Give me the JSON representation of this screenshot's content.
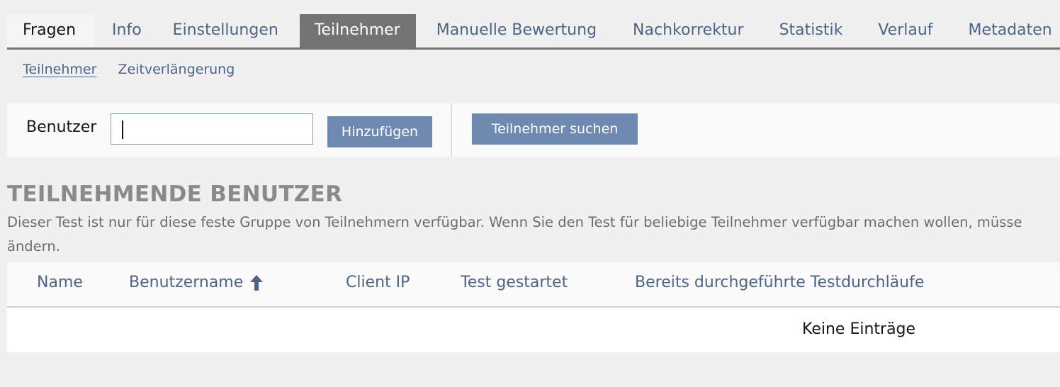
{
  "tabs": [
    {
      "label": "Fragen"
    },
    {
      "label": "Info"
    },
    {
      "label": "Einstellungen"
    },
    {
      "label": "Teilnehmer"
    },
    {
      "label": "Manuelle Bewertung"
    },
    {
      "label": "Nachkorrektur"
    },
    {
      "label": "Statistik"
    },
    {
      "label": "Verlauf"
    },
    {
      "label": "Metadaten"
    }
  ],
  "subtabs": [
    {
      "label": "Teilnehmer"
    },
    {
      "label": "Zeitverlängerung"
    }
  ],
  "toolbar": {
    "user_label": "Benutzer",
    "user_value": "",
    "add_label": "Hinzufügen",
    "search_label": "Teilnehmer suchen"
  },
  "section": {
    "title": "TEILNEHMENDE BENUTZER",
    "description_line1": "Dieser Test ist nur für diese feste Gruppe von Teilnehmern verfügbar. Wenn Sie den Test für beliebige Teilnehmer verfügbar machen wollen, müsse",
    "description_line2": "ändern."
  },
  "table": {
    "columns": [
      "Name",
      "Benutzername",
      "Client IP",
      "Test gestartet",
      "Bereits durchgeführte Testdurchläufe"
    ],
    "sort_icon": "arrow-up-icon",
    "empty_text": "Keine Einträge"
  },
  "colors": {
    "link": "#4c6586",
    "active_tab": "#737373",
    "button": "#6e8ab0"
  }
}
